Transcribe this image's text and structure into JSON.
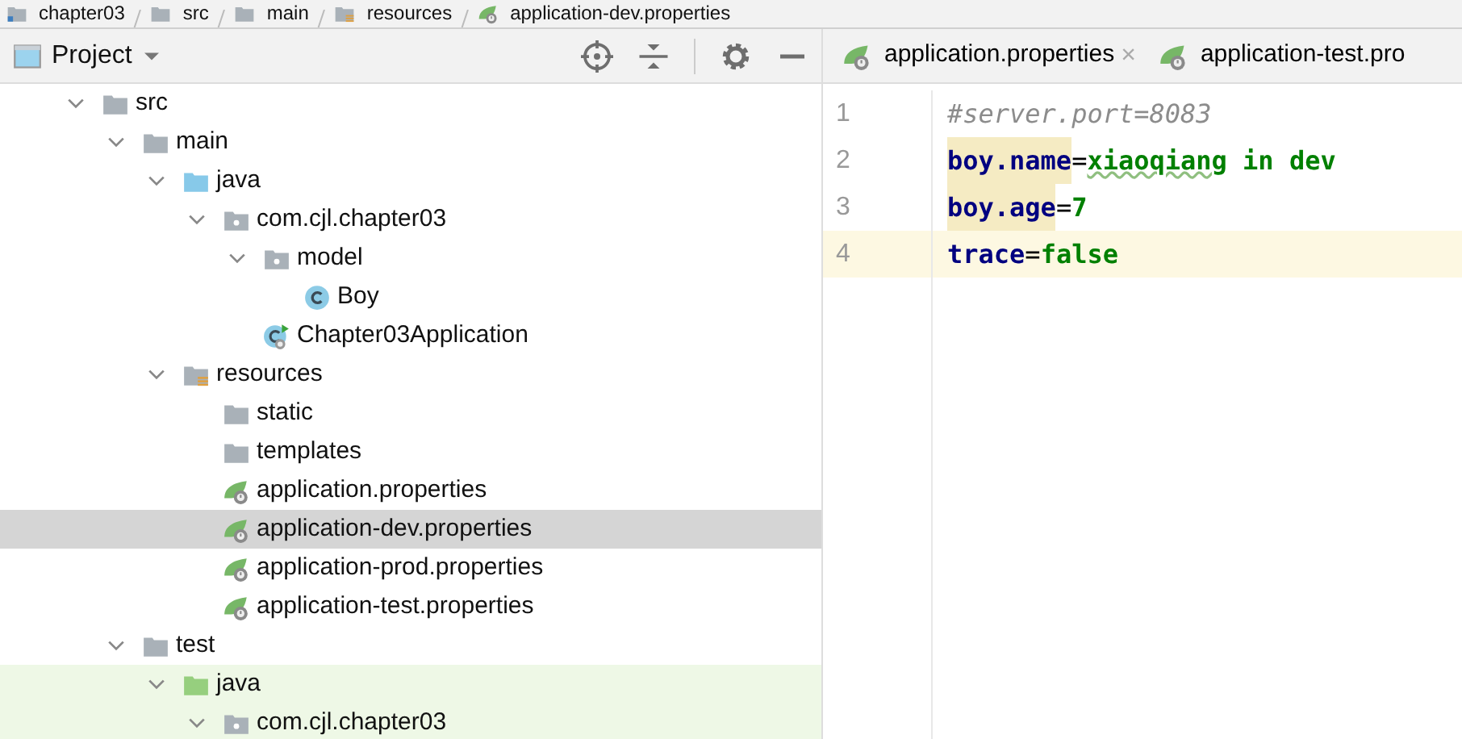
{
  "breadcrumb": [
    {
      "label": "chapter03",
      "kind": "module"
    },
    {
      "label": "src",
      "kind": "folder"
    },
    {
      "label": "main",
      "kind": "folder"
    },
    {
      "label": "resources",
      "kind": "resources"
    },
    {
      "label": "application-dev.properties",
      "kind": "spring"
    }
  ],
  "project_panel": {
    "title": "Project",
    "tree": [
      {
        "label": "src",
        "kind": "folder",
        "expanded": true,
        "selected": false,
        "children": [
          {
            "label": "main",
            "kind": "folder",
            "expanded": true,
            "selected": false,
            "children": [
              {
                "label": "java",
                "kind": "source",
                "expanded": true,
                "selected": false,
                "children": [
                  {
                    "label": "com.cjl.chapter03",
                    "kind": "package",
                    "expanded": true,
                    "selected": false,
                    "children": [
                      {
                        "label": "model",
                        "kind": "package",
                        "expanded": true,
                        "selected": false,
                        "children": [
                          {
                            "label": "Boy",
                            "kind": "class",
                            "selected": false
                          }
                        ]
                      },
                      {
                        "label": "Chapter03Application",
                        "kind": "spring-class",
                        "selected": false
                      }
                    ]
                  }
                ]
              },
              {
                "label": "resources",
                "kind": "resources",
                "expanded": true,
                "selected": false,
                "children": [
                  {
                    "label": "static",
                    "kind": "folder",
                    "selected": false
                  },
                  {
                    "label": "templates",
                    "kind": "folder",
                    "selected": false
                  },
                  {
                    "label": "application.properties",
                    "kind": "spring",
                    "selected": false
                  },
                  {
                    "label": "application-dev.properties",
                    "kind": "spring",
                    "selected": true
                  },
                  {
                    "label": "application-prod.properties",
                    "kind": "spring",
                    "selected": false
                  },
                  {
                    "label": "application-test.properties",
                    "kind": "spring",
                    "selected": false
                  }
                ]
              }
            ]
          },
          {
            "label": "test",
            "kind": "folder",
            "expanded": true,
            "selected": false,
            "children": [
              {
                "label": "java",
                "kind": "test-source",
                "expanded": true,
                "selected": false,
                "children": [
                  {
                    "label": "com.cjl.chapter03",
                    "kind": "package",
                    "expanded": true,
                    "selected": false
                  }
                ]
              }
            ]
          }
        ]
      }
    ]
  },
  "editor_tabs": [
    {
      "label": "application.properties",
      "close": "×",
      "selected": false
    },
    {
      "label": "application-test.pro",
      "selected": false
    }
  ],
  "code_lines": [
    {
      "number": "1",
      "current": false,
      "tokens": [
        {
          "text": "#server.port=8083",
          "kind": "comment"
        }
      ]
    },
    {
      "number": "2",
      "current": false,
      "tokens": [
        {
          "text": "boy.name",
          "kind": "key",
          "highlighted": true
        },
        {
          "text": "=",
          "kind": "sep"
        },
        {
          "text": "xiaoqiang",
          "kind": "value",
          "typo": true
        },
        {
          "text": " in dev",
          "kind": "value"
        }
      ]
    },
    {
      "number": "3",
      "current": false,
      "tokens": [
        {
          "text": "boy.age",
          "kind": "key",
          "highlighted": true
        },
        {
          "text": "=",
          "kind": "sep"
        },
        {
          "text": "7",
          "kind": "value"
        }
      ]
    },
    {
      "number": "4",
      "current": true,
      "tokens": [
        {
          "text": "trace",
          "kind": "key",
          "highlighted": false
        },
        {
          "text": "=",
          "kind": "sep"
        },
        {
          "text": "false",
          "kind": "value"
        }
      ]
    }
  ]
}
